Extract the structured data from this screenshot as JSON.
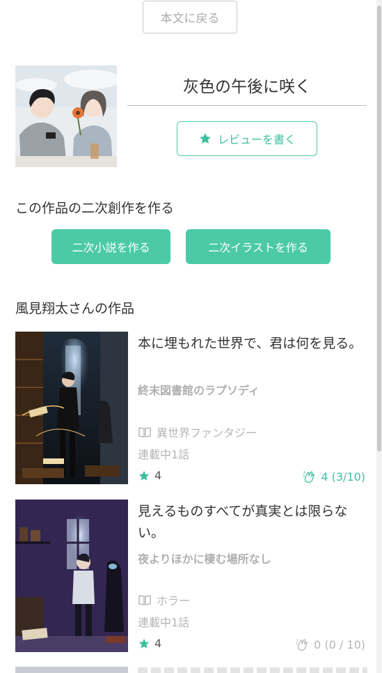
{
  "back_label": "本文に戻る",
  "work": {
    "title": "灰色の午後に咲く",
    "review_label": "レビューを書く"
  },
  "derivative": {
    "heading": "この作品の二次創作を作る",
    "novel_label": "二次小説を作る",
    "illust_label": "二次イラストを作る"
  },
  "author_works": {
    "heading": "風見翔太さんの作品",
    "items": [
      {
        "title": "本に埋もれた世界で、君は何を見る。",
        "subtitle": "終末図書館のラプソディ",
        "genre": "異世界ファンタジー",
        "status": "連載中1話",
        "stars": "4",
        "cheer": "4 (3/10)",
        "cheer_active": true
      },
      {
        "title": "見えるものすべてが真実とは限らない。",
        "subtitle": "夜よりほかに棲む場所なし",
        "genre": "ホラー",
        "status": "連載中1話",
        "stars": "4",
        "cheer": "0 (0 / 10)",
        "cheer_active": false
      }
    ]
  },
  "colors": {
    "accent": "#4ccaa8",
    "star": "#3fbf9e",
    "muted": "#b5b5b5"
  }
}
